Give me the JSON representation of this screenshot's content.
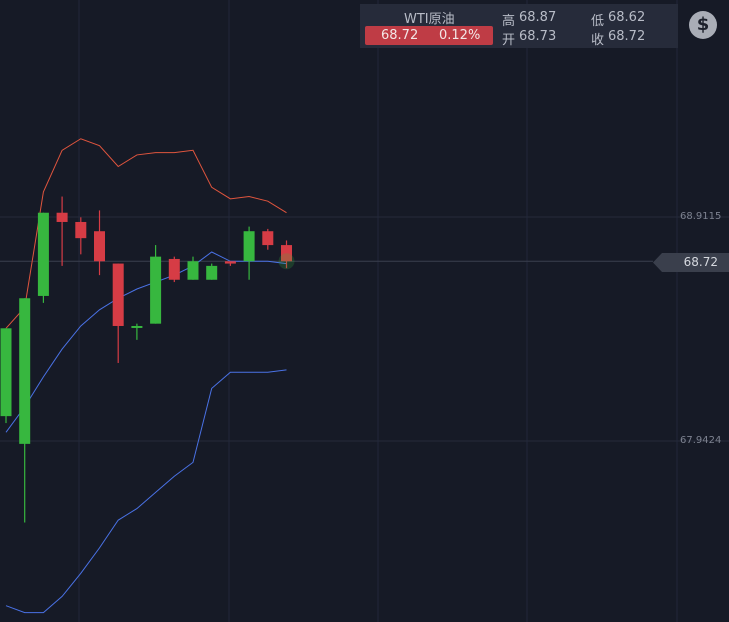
{
  "quote": {
    "name": "WTI原油",
    "price": "68.72",
    "change_pct": "0.12%",
    "high_label": "高",
    "high": "68.87",
    "low_label": "低",
    "low": "68.62",
    "open_label": "开",
    "open": "68.73",
    "close_label": "收",
    "close": "68.72"
  },
  "icons": {
    "currency": "dollar-icon"
  },
  "currency_button_glyph": "$",
  "y_axis_labels": [
    "68.9115",
    "67.9424"
  ],
  "current_price_tag": "68.72",
  "colors": {
    "up": "#d63c45",
    "down": "#37b73f",
    "upper_band": "#e0553e",
    "lower_band": "#4a72e6",
    "background": "#161a26"
  },
  "chart_data": {
    "type": "candlestick",
    "ylim": [
      67.01,
      69.69
    ],
    "ticks": [
      68.9115,
      67.9424
    ],
    "candles": [
      {
        "o": 68.05,
        "h": 68.43,
        "l": 68.02,
        "c": 68.43
      },
      {
        "o": 67.93,
        "h": 68.56,
        "l": 67.59,
        "c": 68.56
      },
      {
        "o": 68.57,
        "h": 68.93,
        "l": 68.54,
        "c": 68.93
      },
      {
        "o": 68.93,
        "h": 69.0,
        "l": 68.7,
        "c": 68.89
      },
      {
        "o": 68.89,
        "h": 68.91,
        "l": 68.75,
        "c": 68.82
      },
      {
        "o": 68.85,
        "h": 68.94,
        "l": 68.66,
        "c": 68.72
      },
      {
        "o": 68.71,
        "h": 68.71,
        "l": 68.28,
        "c": 68.44
      },
      {
        "o": 68.44,
        "h": 68.45,
        "l": 68.38,
        "c": 68.44
      },
      {
        "o": 68.45,
        "h": 68.79,
        "l": 68.45,
        "c": 68.74
      },
      {
        "o": 68.73,
        "h": 68.74,
        "l": 68.63,
        "c": 68.64
      },
      {
        "o": 68.64,
        "h": 68.74,
        "l": 68.64,
        "c": 68.72
      },
      {
        "o": 68.64,
        "h": 68.71,
        "l": 68.64,
        "c": 68.7
      },
      {
        "o": 68.72,
        "h": 68.72,
        "l": 68.7,
        "c": 68.71
      },
      {
        "o": 68.72,
        "h": 68.87,
        "l": 68.64,
        "c": 68.85
      },
      {
        "o": 68.85,
        "h": 68.86,
        "l": 68.77,
        "c": 68.79
      },
      {
        "o": 68.79,
        "h": 68.81,
        "l": 68.69,
        "c": 68.72
      }
    ],
    "upper_band": [
      68.43,
      68.52,
      69.02,
      69.2,
      69.25,
      69.22,
      69.13,
      69.18,
      69.19,
      69.19,
      69.2,
      69.04,
      68.99,
      69.0,
      68.98,
      68.93
    ],
    "middle_band": [
      67.98,
      68.09,
      68.22,
      68.34,
      68.44,
      68.51,
      68.56,
      68.6,
      68.63,
      68.66,
      68.7,
      68.76,
      68.72,
      68.72,
      68.72,
      68.71
    ],
    "lower_band": [
      67.23,
      67.2,
      67.2,
      67.27,
      67.37,
      67.48,
      67.6,
      67.65,
      67.72,
      67.79,
      67.85,
      68.17,
      68.24,
      68.24,
      68.24,
      68.25
    ]
  }
}
